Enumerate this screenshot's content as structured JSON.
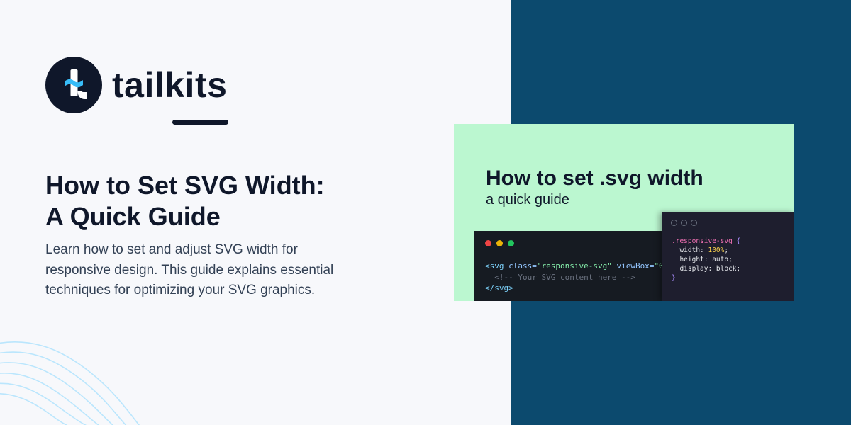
{
  "brand": {
    "name": "tailkits",
    "mark_letter": "t",
    "colors": {
      "dark": "#0f172a",
      "accent": "#38bdf8",
      "panel": "#0c4a6e",
      "card": "#bbf7d0"
    }
  },
  "headline": {
    "line1": "How to Set SVG Width:",
    "line2": "A Quick Guide"
  },
  "description": "Learn how to set and adjust SVG width for responsive design. This guide explains essential techniques for optimizing your SVG graphics.",
  "card": {
    "title": "How to set .svg width",
    "subtitle": "a quick guide",
    "html_code": {
      "line1": {
        "open": "<svg",
        "attr1": " class=",
        "val1": "\"responsive-svg\"",
        "attr2": " viewBox=",
        "val2": "\"0"
      },
      "line2": "  <!-- Your SVG content here -->",
      "line3": "</svg>"
    },
    "css_code": {
      "selector": ".responsive-svg",
      "open_brace": " {",
      "width_prop": "  width: ",
      "width_val": "100%",
      "width_end": ";",
      "height_line": "  height: auto;",
      "display_line": "  display: block;",
      "close_brace": "}"
    },
    "window_dot_colors": [
      "#ef4444",
      "#eab308",
      "#22c55e"
    ]
  }
}
